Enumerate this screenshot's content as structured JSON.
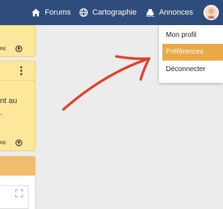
{
  "nav": {
    "items": [
      {
        "label": "Forums",
        "icon": "home-icon"
      },
      {
        "label": "Cartographie",
        "icon": "globe-icon"
      },
      {
        "label": "Annonces",
        "icon": "ship-icon"
      }
    ],
    "avatar_icon": "user-avatar"
  },
  "cards": [
    {
      "footer_text": "RE",
      "footer_icon": "arrow-up-circle-icon"
    },
    {
      "menu_icon": "kebab-menu-icon",
      "text_lines": [
        "nt au",
        "."
      ],
      "footer_text": "RE",
      "footer_icon": "arrow-up-circle-icon"
    }
  ],
  "panel": {
    "expand_icon": "expand-icon"
  },
  "dropdown": {
    "items": [
      {
        "label": "Mon profil",
        "active": false
      },
      {
        "label": "Préférences",
        "active": true
      },
      {
        "label": "Déconnecter",
        "active": false
      }
    ]
  },
  "annotation": {
    "type": "hand-drawn-arrow",
    "color": "#e0402a"
  },
  "colors": {
    "topbar": "#2e4d7c",
    "card_yellow": "#fce79a",
    "panel_header": "#efbd6e",
    "dropdown_active": "#e8a946",
    "background": "#ececec"
  }
}
